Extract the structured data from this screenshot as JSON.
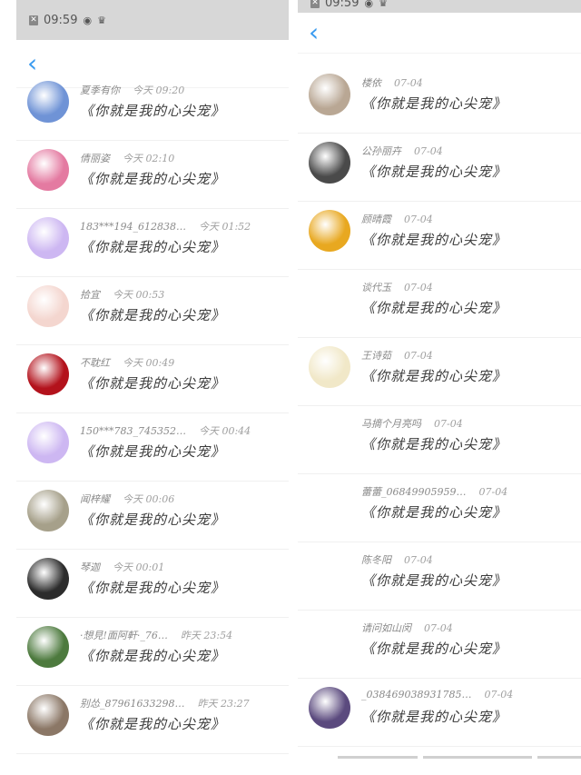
{
  "left": {
    "status": {
      "time": "09:59"
    },
    "nav": {
      "back_label": "‹"
    },
    "rows": [
      {
        "name": "夏季有你",
        "time": "今天 09:20",
        "msg": "《你就是我的心尖宠》",
        "avatar": "#6f93d6"
      },
      {
        "name": "倩丽姿",
        "time": "今天 02:10",
        "msg": "《你就是我的心尖宠》",
        "avatar": "#e47aa1"
      },
      {
        "name": "183***194_612838…",
        "time": "今天 01:52",
        "msg": "《你就是我的心尖宠》",
        "avatar": "#cdb7f2"
      },
      {
        "name": "拾宜",
        "time": "今天 00:53",
        "msg": "《你就是我的心尖宠》",
        "avatar": "#f4d6cf"
      },
      {
        "name": "不耽红",
        "time": "今天 00:49",
        "msg": "《你就是我的心尖宠》",
        "avatar": "#b3121c"
      },
      {
        "name": "150***783_745352…",
        "time": "今天 00:44",
        "msg": "《你就是我的心尖宠》",
        "avatar": "#cdb7f2"
      },
      {
        "name": "闻梓耀",
        "time": "今天 00:06",
        "msg": "《你就是我的心尖宠》",
        "avatar": "#a6a08a"
      },
      {
        "name": "琴迦",
        "time": "今天 00:01",
        "msg": "《你就是我的心尖宠》",
        "avatar": "#2c2c2c"
      },
      {
        "name": "·想見!面阿軒·_76…",
        "time": "昨天 23:54",
        "msg": "《你就是我的心尖宠》",
        "avatar": "#4d7a3e"
      },
      {
        "name": "别怂_87961633298…",
        "time": "昨天 23:27",
        "msg": "《你就是我的心尖宠》",
        "avatar": "#8b7766"
      }
    ]
  },
  "right": {
    "status": {
      "time": "09:59"
    },
    "nav": {
      "back_label": "‹"
    },
    "rows": [
      {
        "name": "楼依",
        "time": "07-04",
        "msg": "《你就是我的心尖宠》",
        "avatar": "#b9a794"
      },
      {
        "name": "公孙丽卉",
        "time": "07-04",
        "msg": "《你就是我的心尖宠》",
        "avatar": "#4a4a4a"
      },
      {
        "name": "顾晴霞",
        "time": "07-04",
        "msg": "《你就是我的心尖宠》",
        "avatar": "#e8a820"
      },
      {
        "name": "谈代玉",
        "time": "07-04",
        "msg": "《你就是我的心尖宠》",
        "avatar": "#ffffff"
      },
      {
        "name": "王诗茹",
        "time": "07-04",
        "msg": "《你就是我的心尖宠》",
        "avatar": "#f1e8c8"
      },
      {
        "name": "马摘个月亮吗",
        "time": "07-04",
        "msg": "《你就是我的心尖宠》",
        "avatar": "#ffffff"
      },
      {
        "name": "蕾蕾_06849905959…",
        "time": "07-04",
        "msg": "《你就是我的心尖宠》",
        "avatar": "#ffffff"
      },
      {
        "name": "陈冬阳",
        "time": "07-04",
        "msg": "《你就是我的心尖宠》",
        "avatar": "#ffffff"
      },
      {
        "name": "请问如山闵",
        "time": "07-04",
        "msg": "《你就是我的心尖宠》",
        "avatar": "#ffffff"
      },
      {
        "name": "_038469038931785…",
        "time": "07-04",
        "msg": "《你就是我的心尖宠》",
        "avatar": "#5b4a7e"
      }
    ]
  }
}
